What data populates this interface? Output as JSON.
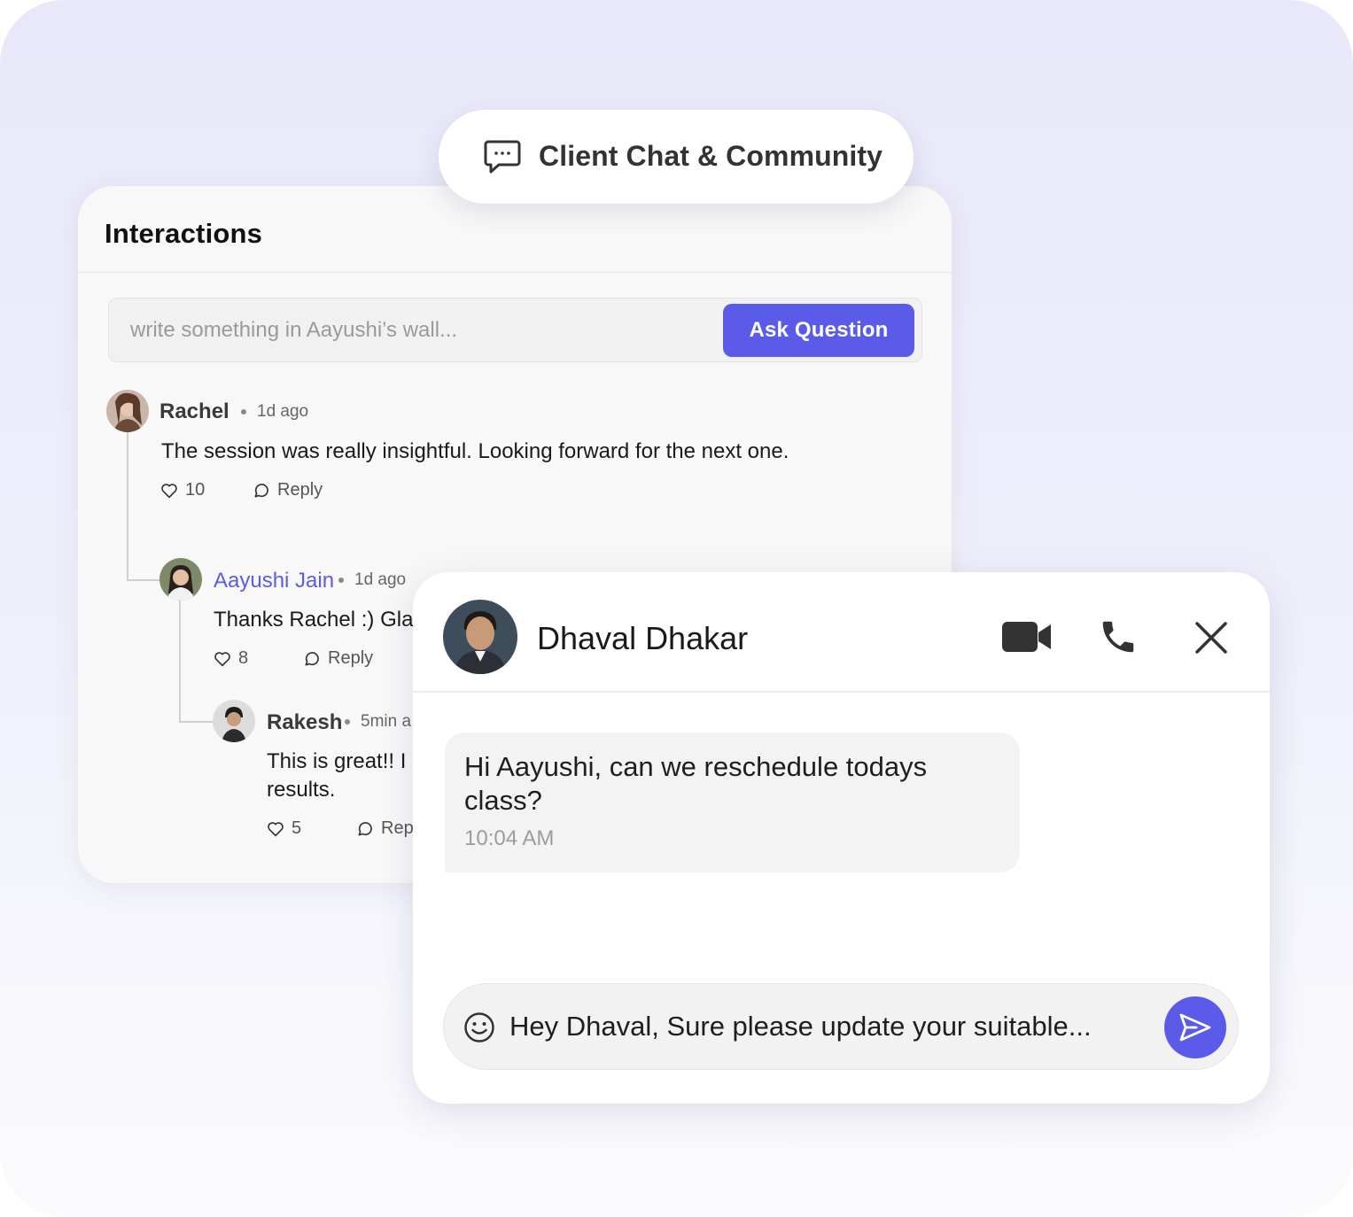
{
  "badge": {
    "title": "Client Chat & Community",
    "icon": "chat-bubble-icon"
  },
  "interactions": {
    "title": "Interactions",
    "wall_placeholder": "write something in Aayushi’s wall...",
    "ask_button": "Ask Question",
    "comments": [
      {
        "author": "Rachel",
        "time": "1d ago",
        "text": "The session was really insightful. Looking forward for the next one.",
        "likes": "10",
        "reply_label": "Reply"
      },
      {
        "author": "Aayushi Jain",
        "time": "1d ago",
        "text": "Thanks Rachel :) Gla",
        "likes": "8",
        "reply_label": "Reply"
      },
      {
        "author": "Rakesh",
        "time": "5min a",
        "text_lines": [
          "This is great!! I",
          "results."
        ],
        "likes": "5",
        "reply_label": "Rep"
      }
    ]
  },
  "chat": {
    "contact_name": "Dhaval Dhakar",
    "header_icons": [
      "video-camera-icon",
      "phone-icon",
      "close-icon"
    ],
    "messages": [
      {
        "text": "Hi Aayushi, can we reschedule todays class?",
        "time": "10:04 AM"
      }
    ],
    "compose_value": "Hey Dhaval, Sure please update your suitable...",
    "compose_icons": [
      "emoji-icon",
      "send-icon"
    ]
  },
  "colors": {
    "accent": "#5b5bea",
    "background": "#e8e8fa",
    "card": "#f8f8f8"
  }
}
